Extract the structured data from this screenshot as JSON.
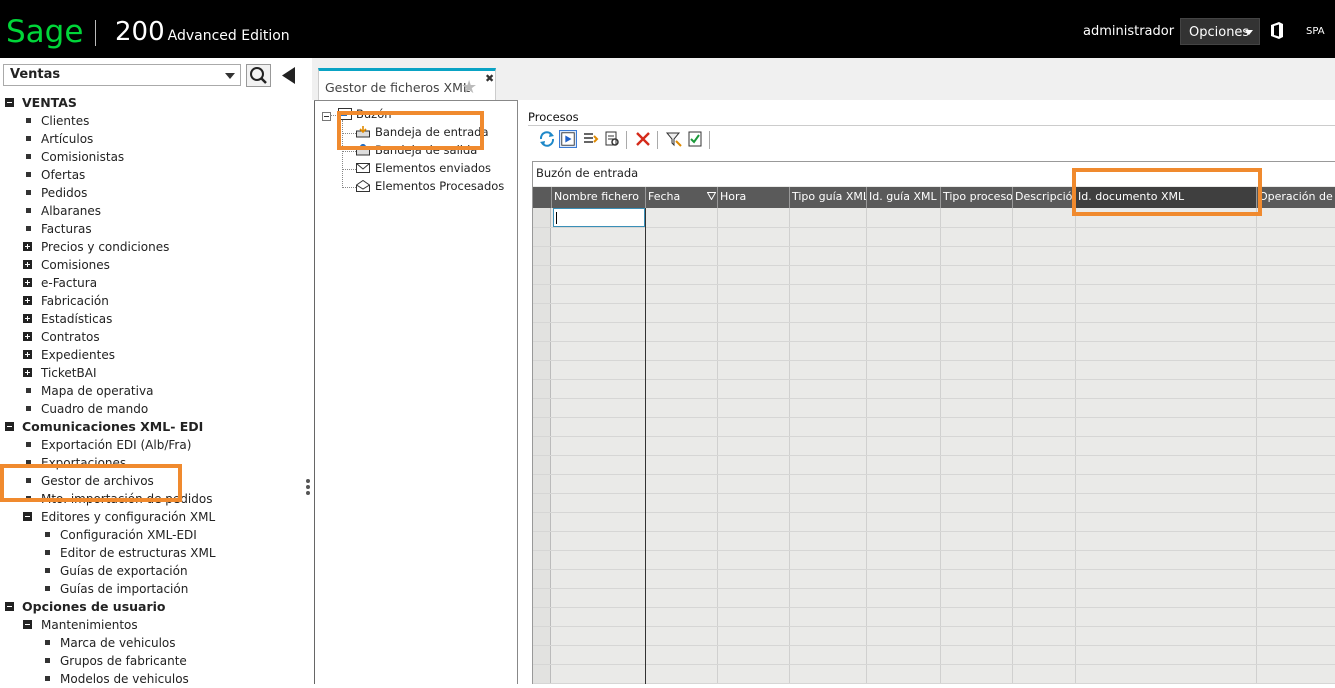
{
  "header": {
    "logo_text": "Sage",
    "product_number": "200",
    "product_edition": "Advanced Edition",
    "user": "administrador",
    "options_label": "Opciones",
    "language": "SPA"
  },
  "sidebar": {
    "module": "Ventas",
    "items": [
      {
        "label": "VENTAS",
        "level": 0,
        "marker": "minus"
      },
      {
        "label": "Clientes",
        "level": 1,
        "marker": "bullet"
      },
      {
        "label": "Artículos",
        "level": 1,
        "marker": "bullet"
      },
      {
        "label": "Comisionistas",
        "level": 1,
        "marker": "bullet"
      },
      {
        "label": "Ofertas",
        "level": 1,
        "marker": "bullet"
      },
      {
        "label": "Pedidos",
        "level": 1,
        "marker": "bullet"
      },
      {
        "label": "Albaranes",
        "level": 1,
        "marker": "bullet"
      },
      {
        "label": "Facturas",
        "level": 1,
        "marker": "bullet"
      },
      {
        "label": "Precios y condiciones",
        "level": 1,
        "marker": "plus"
      },
      {
        "label": "Comisiones",
        "level": 1,
        "marker": "plus"
      },
      {
        "label": "e-Factura",
        "level": 1,
        "marker": "plus"
      },
      {
        "label": "Fabricación",
        "level": 1,
        "marker": "plus"
      },
      {
        "label": "Estadísticas",
        "level": 1,
        "marker": "plus"
      },
      {
        "label": "Contratos",
        "level": 1,
        "marker": "plus"
      },
      {
        "label": "Expedientes",
        "level": 1,
        "marker": "plus"
      },
      {
        "label": "TicketBAI",
        "level": 1,
        "marker": "plus"
      },
      {
        "label": "Mapa de operativa",
        "level": 1,
        "marker": "bullet"
      },
      {
        "label": "Cuadro de mando",
        "level": 1,
        "marker": "bullet"
      },
      {
        "label": "Comunicaciones XML- EDI",
        "level": 0,
        "marker": "minus"
      },
      {
        "label": "Exportación EDI (Alb/Fra)",
        "level": 1,
        "marker": "bullet"
      },
      {
        "label": "Exportaciones",
        "level": 1,
        "marker": "bullet"
      },
      {
        "label": "Gestor de archivos",
        "level": 1,
        "marker": "bullet"
      },
      {
        "label": "Mto. importación de pedidos",
        "level": 1,
        "marker": "bullet"
      },
      {
        "label": "Editores y configuración XML",
        "level": 1,
        "marker": "minus"
      },
      {
        "label": "Configuración XML-EDI",
        "level": 2,
        "marker": "bullet"
      },
      {
        "label": "Editor de estructuras XML",
        "level": 2,
        "marker": "bullet"
      },
      {
        "label": "Guías de exportación",
        "level": 2,
        "marker": "bullet"
      },
      {
        "label": "Guías de importación",
        "level": 2,
        "marker": "bullet"
      },
      {
        "label": "Opciones de usuario",
        "level": 0,
        "marker": "minus"
      },
      {
        "label": "Mantenimientos",
        "level": 1,
        "marker": "minus"
      },
      {
        "label": "Marca de vehiculos",
        "level": 2,
        "marker": "bullet"
      },
      {
        "label": "Grupos de fabricante",
        "level": 2,
        "marker": "bullet"
      },
      {
        "label": "Modelos de vehiculos",
        "level": 2,
        "marker": "bullet"
      }
    ]
  },
  "tab": {
    "label": "Gestor de ficheros XML"
  },
  "tree": {
    "root": "Buzón",
    "nodes": [
      "Bandeja de entrada",
      "Bandeja de salida",
      "Elementos enviados",
      "Elementos Procesados"
    ]
  },
  "main": {
    "section_label": "Procesos",
    "grid_title": "Buzón de entrada",
    "columns": [
      "Nombre fichero",
      "Fecha",
      "Hora",
      "Tipo guía XML",
      "Id. guía XML",
      "Tipo proceso",
      "Descripción",
      "Id. documento XML",
      "Operación de m"
    ]
  },
  "colors": {
    "brand_green": "#00d639",
    "tab_accent": "#0aa3c4",
    "highlight": "#f08a2e",
    "grid_header": "#5a5a5a"
  }
}
